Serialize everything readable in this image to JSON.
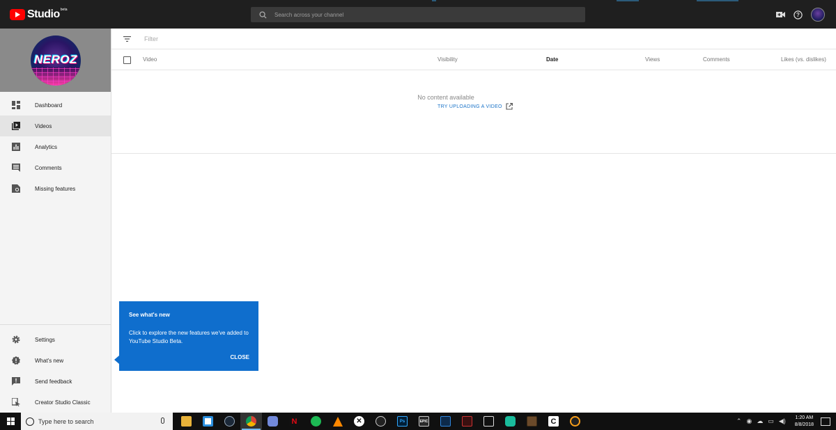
{
  "app": {
    "studio_label": "Studio",
    "beta_label": "beta"
  },
  "search": {
    "placeholder": "Search across your channel"
  },
  "channel": {
    "name": "NEROZ"
  },
  "sidebar": {
    "items": [
      {
        "label": "Dashboard",
        "icon": "dashboard-icon"
      },
      {
        "label": "Videos",
        "icon": "videos-icon"
      },
      {
        "label": "Analytics",
        "icon": "analytics-icon"
      },
      {
        "label": "Comments",
        "icon": "comments-icon"
      },
      {
        "label": "Missing features",
        "icon": "missing-features-icon"
      }
    ],
    "bottom_items": [
      {
        "label": "Settings",
        "icon": "gear-icon"
      },
      {
        "label": "What's new",
        "icon": "whats-new-icon"
      },
      {
        "label": "Send feedback",
        "icon": "feedback-icon"
      },
      {
        "label": "Creator Studio Classic",
        "icon": "classic-icon"
      }
    ]
  },
  "filter": {
    "label": "Filter"
  },
  "table": {
    "columns": {
      "video": "Video",
      "visibility": "Visibility",
      "date": "Date",
      "views": "Views",
      "comments": "Comments",
      "likes": "Likes (vs. dislikes)"
    },
    "empty_text": "No content available",
    "upload_link": "TRY UPLOADING A VIDEO"
  },
  "popup": {
    "title": "See what's new",
    "body": "Click to explore the new features we've added to YouTube Studio Beta.",
    "close": "CLOSE"
  },
  "taskbar": {
    "search_placeholder": "Type here to search",
    "apps": [
      "file-explorer",
      "store",
      "steam",
      "chrome",
      "discord",
      "netflix",
      "spotify",
      "vlc",
      "xbox",
      "obs",
      "photoshop",
      "epic-games",
      "app-blue",
      "app-red",
      "app-film",
      "app-green",
      "minecraft",
      "app-c",
      "overwatch"
    ],
    "time": "1:20 AM",
    "date": "8/8/2018"
  },
  "colors": {
    "accent": "#0f6ecd",
    "topbar": "#1f1f1f",
    "link": "#1a73c8",
    "youtube_red": "#ff0000"
  }
}
